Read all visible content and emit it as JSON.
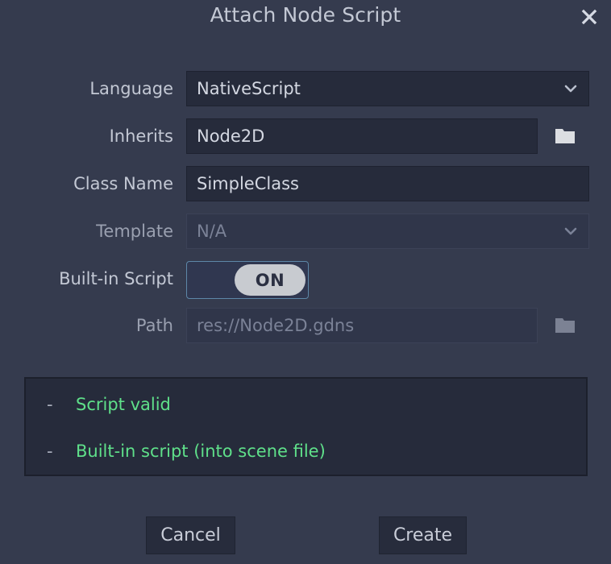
{
  "dialog": {
    "title": "Attach Node Script",
    "close_icon": "close-icon"
  },
  "form": {
    "language": {
      "label": "Language",
      "value": "NativeScript",
      "icon": "chevron-down-icon"
    },
    "inherits": {
      "label": "Inherits",
      "value": "Node2D",
      "browse_icon": "folder-icon"
    },
    "class_name": {
      "label": "Class Name",
      "value": "SimpleClass"
    },
    "template": {
      "label": "Template",
      "value": "N/A",
      "icon": "chevron-down-icon"
    },
    "builtin_script": {
      "label": "Built-in Script",
      "state": "ON"
    },
    "path": {
      "label": "Path",
      "value": "res://Node2D.gdns",
      "browse_icon": "folder-icon"
    }
  },
  "status": {
    "bullet": "-",
    "lines": [
      {
        "bullet": "-",
        "text": "Script valid"
      },
      {
        "bullet": "-",
        "text": "Built-in script (into scene file)"
      }
    ]
  },
  "footer": {
    "cancel_label": "Cancel",
    "create_label": "Create"
  },
  "colors": {
    "dialog_background": "#353b4e",
    "field_background": "#262b3b",
    "field_disabled_background": "#30364a",
    "text": "#c3c8d4",
    "text_disabled": "#7b8297",
    "status_valid": "#5fe08a",
    "toggle_focus_border": "#5d87a8",
    "toggle_knob": "#c8cbd0"
  }
}
